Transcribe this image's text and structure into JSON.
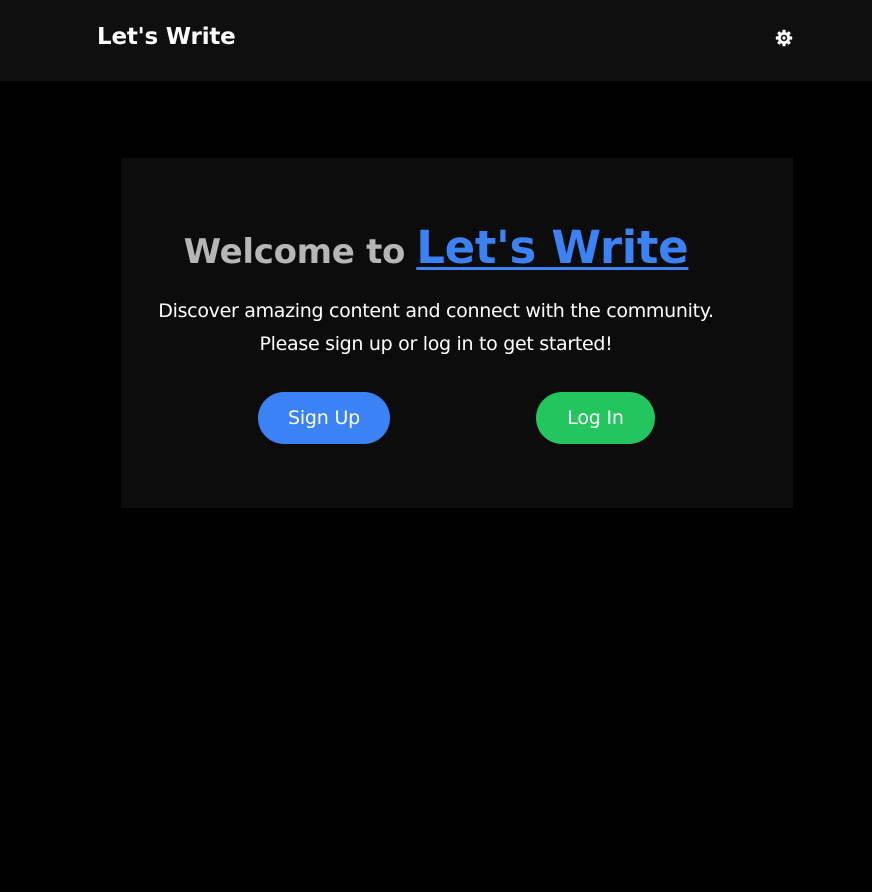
{
  "navbar": {
    "brand": "Let's Write",
    "theme_toggle_icon": "gear-icon"
  },
  "hero": {
    "welcome_text": "Welcome to",
    "brand_link": "Let's Write",
    "tagline_line1": "Discover amazing content and connect with the community.",
    "tagline_line2": "Please sign up or log in to get started!"
  },
  "actions": {
    "signup_label": "Sign Up",
    "login_label": "Log In"
  },
  "colors": {
    "background": "#000000",
    "navbar": "#0f0f0f",
    "card": "#0c0c0c",
    "primary": "#3b82f6",
    "success": "#22c55e",
    "muted_heading": "#b6b6b6"
  }
}
